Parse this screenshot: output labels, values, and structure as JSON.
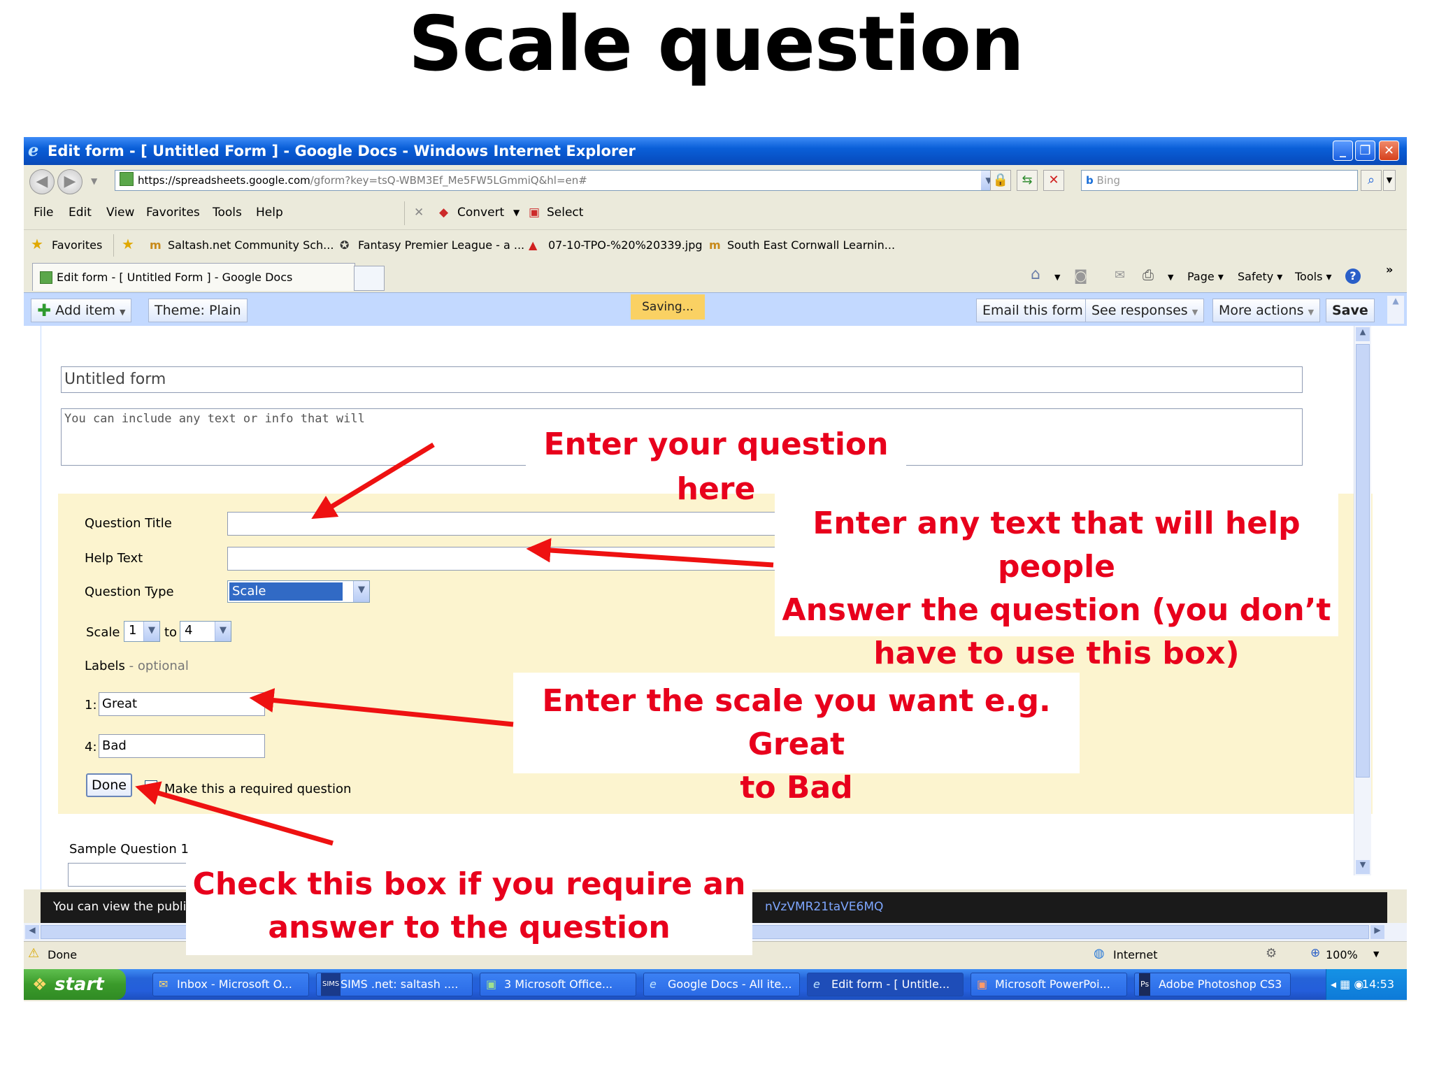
{
  "slide": {
    "title": "Scale question"
  },
  "window": {
    "title": "Edit form - [ Untitled Form ] - Google Docs - Windows Internet Explorer",
    "address_prefix": "https://spreadsheets.",
    "address_host": "google.com",
    "address_suffix": "/gform?key=tsQ-WBM3Ef_Me5FW5LGmmiQ&hl=en#",
    "search_placeholder": "Bing",
    "menu": [
      "File",
      "Edit",
      "View",
      "Favorites",
      "Tools",
      "Help"
    ],
    "convert_label": "Convert",
    "select_label": "Select",
    "favorites_label": "Favorites",
    "favorites_links": [
      "Saltash.net Community Sch...",
      "Fantasy Premier League - a ...",
      "07-10-TPO-%20%20339.jpg",
      "South East Cornwall Learnin..."
    ],
    "tab_label": "Edit form - [ Untitled Form ] - Google Docs",
    "command_bar": {
      "page": "Page",
      "safety": "Safety",
      "tools": "Tools"
    },
    "status_text": "Done",
    "zone_text": "Internet",
    "zoom_text": "100%"
  },
  "gdocs_toolbar": {
    "add_item": "Add item",
    "theme_label": "Theme:",
    "theme_value": "Plain",
    "saving": "Saving...",
    "email_form": "Email this form",
    "see_responses": "See responses",
    "more_actions": "More actions",
    "save": "Save"
  },
  "form": {
    "title_value": "Untitled form",
    "description_value": "You can include any text or info that will",
    "question_title_label": "Question Title",
    "help_text_label": "Help Text",
    "question_type_label": "Question Type",
    "question_type_value": "Scale",
    "scale_label": "Scale",
    "scale_from": "1",
    "scale_to_word": "to",
    "scale_to": "4",
    "labels_label": "Labels",
    "labels_optional": "- optional",
    "label1_num": "1:",
    "label1_value": "Great",
    "label4_num": "4:",
    "label4_value": "Bad",
    "done_button": "Done",
    "required_text": "Make this a required question",
    "sample_question": "Sample Question 1",
    "footer_text_left": "You can view the publi",
    "footer_text_right": "nVzVMR21taVE6MQ"
  },
  "taskbar": {
    "start": "start",
    "tasks": [
      "Inbox - Microsoft O...",
      "SIMS .net: saltash ....",
      "3 Microsoft Office...",
      "Google Docs - All ite...",
      "Edit form - [ Untitle...",
      "Microsoft PowerPoi...",
      "Adobe Photoshop CS3"
    ],
    "clock": "14:53"
  },
  "callouts": {
    "question": "Enter your question here",
    "help_line1": "Enter any text that will help people",
    "help_line2": "Answer the question (you don’t",
    "help_line3": "have to use this box)",
    "scale_line1": "Enter the scale you want e.g. Great",
    "scale_line2": "to Bad",
    "check_line1": "Check this box if you require an",
    "check_line2": "answer to the question"
  },
  "colors": {
    "callout_text": "#e8001c",
    "arrow": "#ee1111",
    "gdocs_toolbar": "#c3d9ff",
    "editing_block": "#fcf4cf",
    "saving_badge": "#fad163"
  }
}
